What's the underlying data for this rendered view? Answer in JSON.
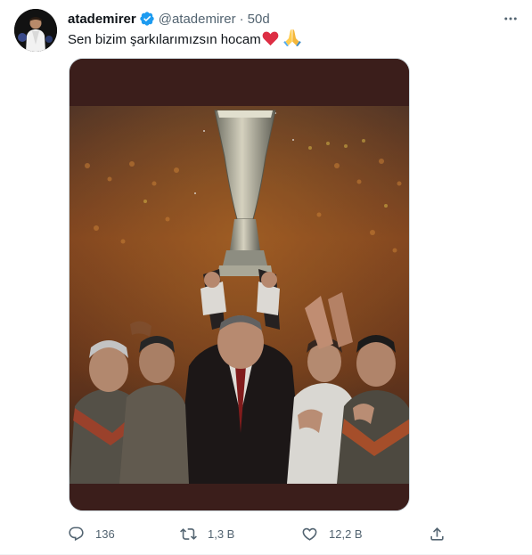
{
  "tweet": {
    "display_name": "atademirer",
    "handle": "@atademirer",
    "separator": "·",
    "time": "50d",
    "text": "Sen bizim şarkılarımızsın hocam",
    "accent_color": "#1d9bf0",
    "icons": [
      "verified-badge-icon",
      "more-icon",
      "red-heart-emoji",
      "folded-hands-emoji"
    ]
  },
  "actions": {
    "reply": {
      "icon": "reply-icon",
      "count": "136"
    },
    "retweet": {
      "icon": "retweet-icon",
      "count": "1,3 B"
    },
    "like": {
      "icon": "like-icon",
      "count": "12,2 B"
    },
    "share": {
      "icon": "share-icon"
    }
  }
}
